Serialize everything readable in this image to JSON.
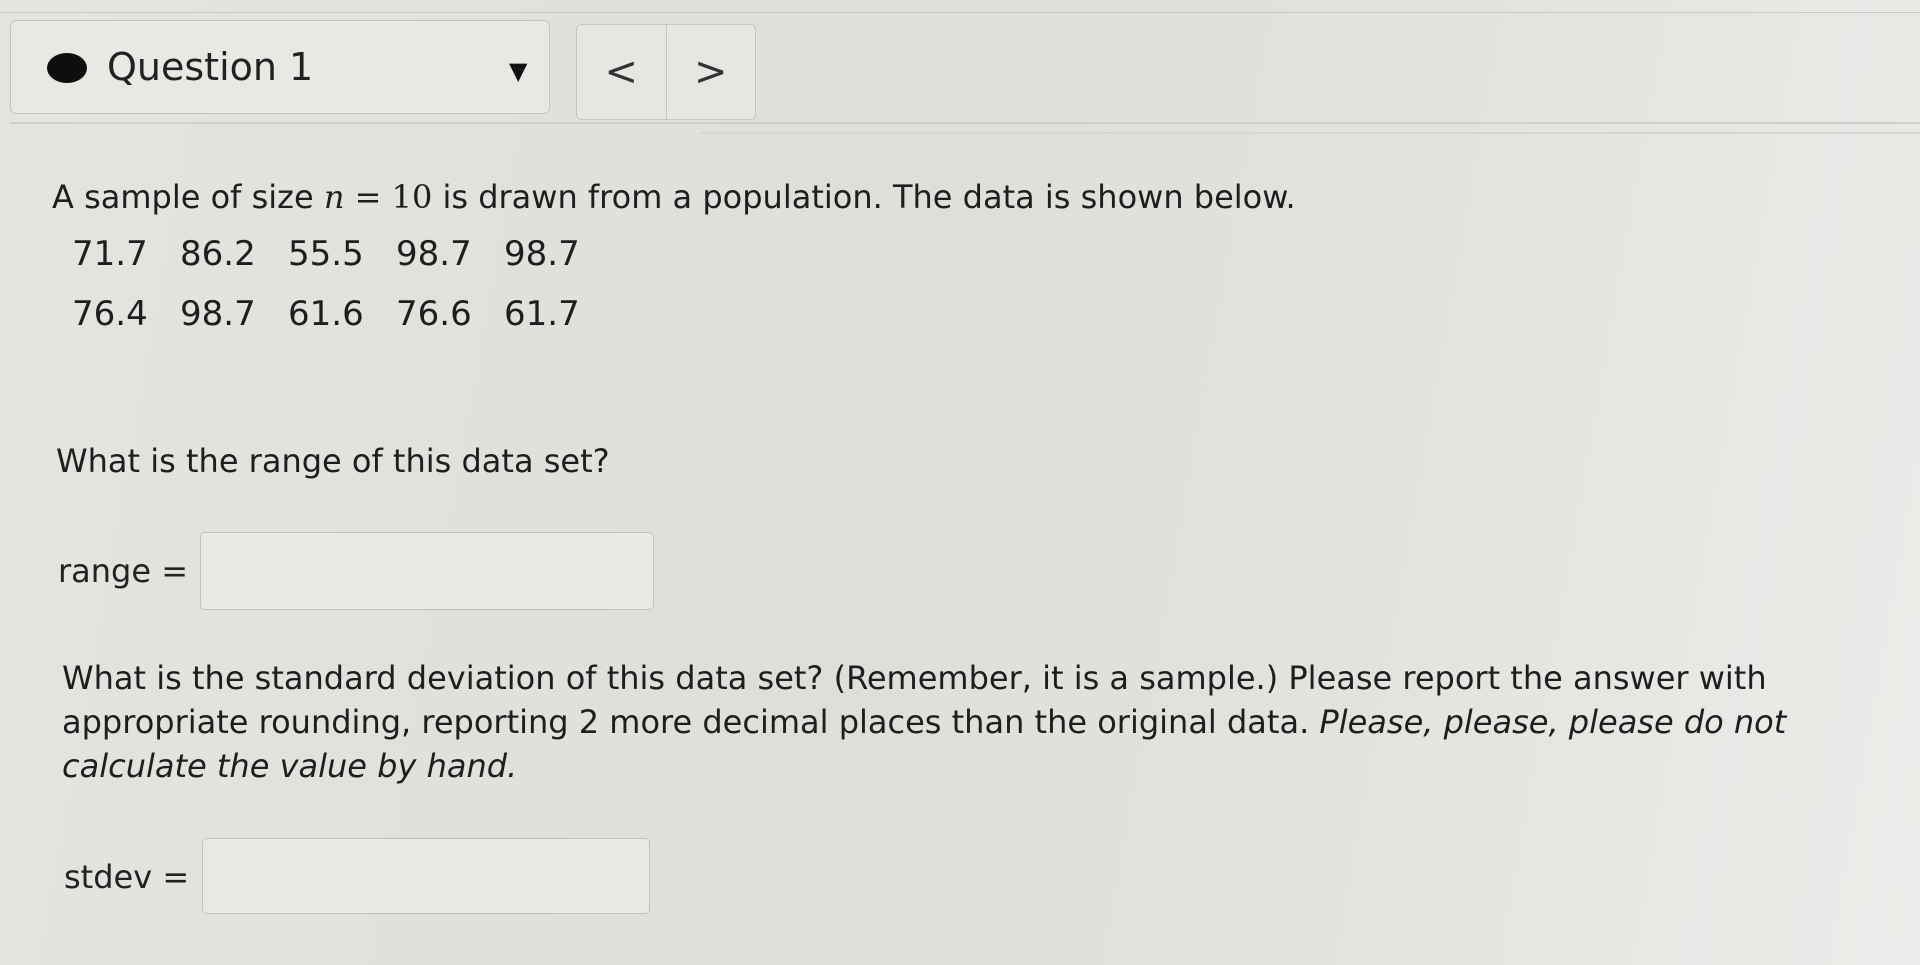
{
  "question_nav": {
    "title": "Question 1",
    "prev_label": "<",
    "next_label": ">"
  },
  "problem": {
    "intro_before": "A sample of size",
    "n_var": "n",
    "equals": "=",
    "n_value": "10",
    "intro_after": "is drawn from a population. The data is shown below.",
    "data_rows": [
      [
        "71.7",
        "86.2",
        "55.5",
        "98.7",
        "98.7"
      ],
      [
        "76.4",
        "98.7",
        "61.6",
        "76.6",
        "61.7"
      ]
    ]
  },
  "range_question": {
    "prompt": "What is the range of this data set?",
    "label": "range =",
    "value": ""
  },
  "stdev_question": {
    "prompt": "What is the standard deviation of this data set? (Remember, it is a sample.) Please report the answer with appropriate rounding, reporting 2 more decimal places than the original data.",
    "emphasis": "Please, please, please do not calculate the value by hand.",
    "label": "stdev =",
    "value": ""
  }
}
